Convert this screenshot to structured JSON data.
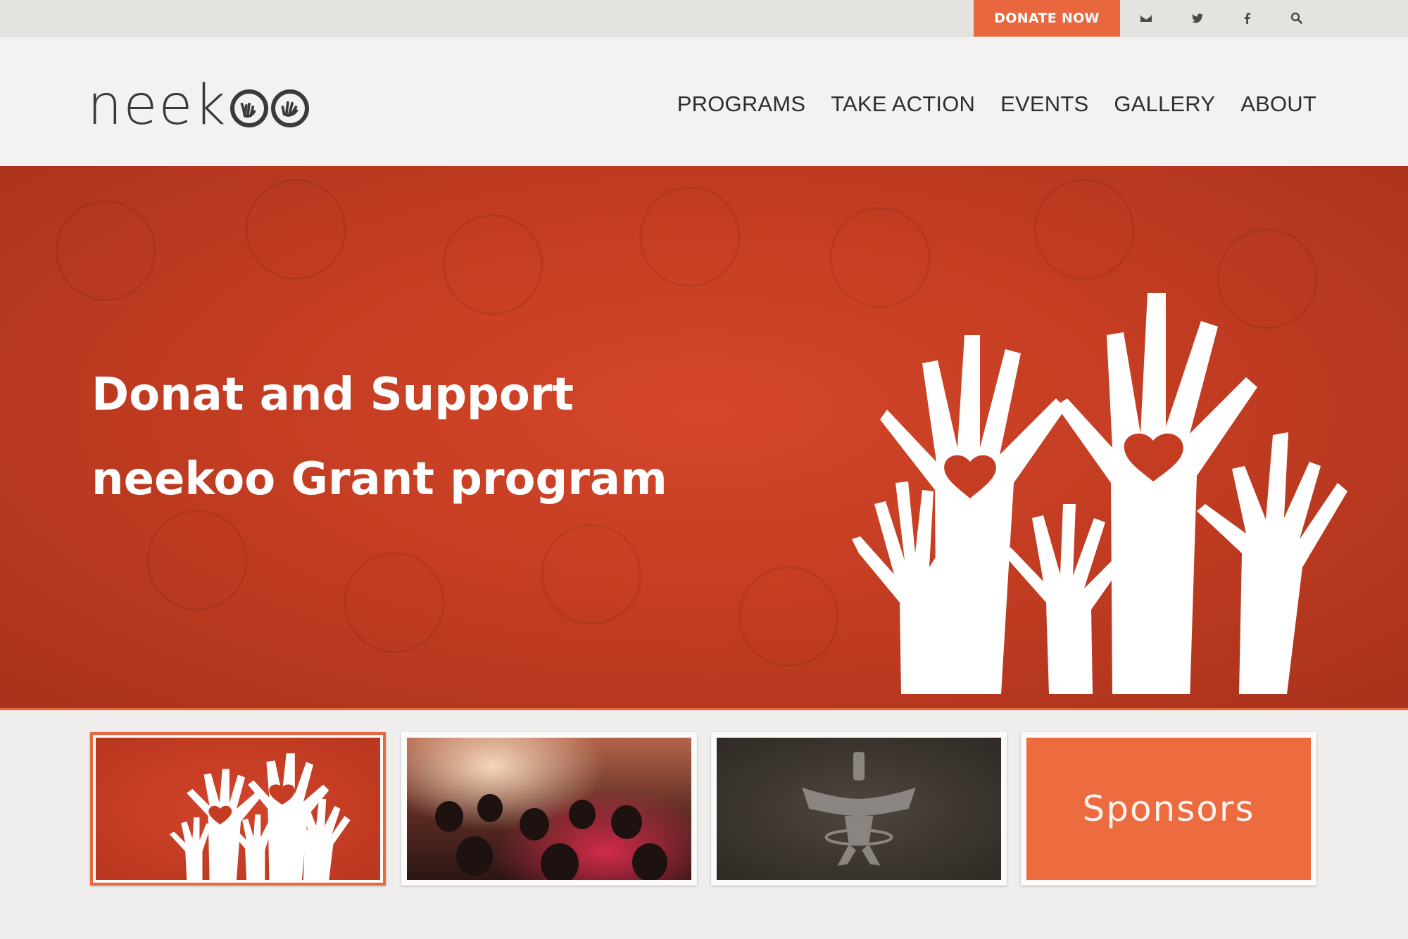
{
  "topbar": {
    "donate_label": "DONATE NOW",
    "icons": [
      "mail-icon",
      "twitter-icon",
      "facebook-icon",
      "search-icon"
    ]
  },
  "header": {
    "logo_text": "neek",
    "nav": [
      "PROGRAMS",
      "TAKE ACTION",
      "EVENTS",
      "GALLERY",
      "ABOUT"
    ]
  },
  "hero": {
    "title_line1": "Donat and Support",
    "title_line2": "neekoo Grant program",
    "background_color": "#c43d22"
  },
  "thumbnails": [
    {
      "name": "hands-thumbnail",
      "label": ""
    },
    {
      "name": "event-crowd-thumbnail",
      "label": ""
    },
    {
      "name": "faravahar-thumbnail",
      "label": ""
    },
    {
      "name": "sponsors-thumbnail",
      "label": "Sponsors"
    }
  ],
  "colors": {
    "accent": "#e8673f",
    "hero": "#c43d22",
    "text_dark": "#2e2e2e"
  }
}
